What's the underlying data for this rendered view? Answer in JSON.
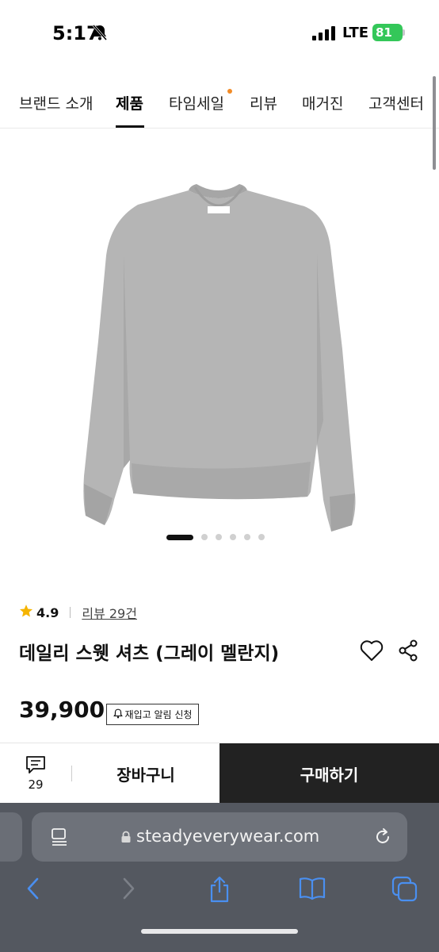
{
  "status_bar": {
    "time": "5:17",
    "network": "LTE",
    "battery": "81",
    "icons": [
      "bell-slash-icon",
      "signal-icon",
      "battery-icon"
    ]
  },
  "nav": {
    "items": [
      {
        "label": "브랜드 소개",
        "active": false
      },
      {
        "label": "제품",
        "active": true
      },
      {
        "label": "타임세일",
        "active": false,
        "badge": "new-dot"
      },
      {
        "label": "리뷰",
        "active": false
      },
      {
        "label": "매거진",
        "active": false
      },
      {
        "label": "고객센터",
        "active": false
      }
    ]
  },
  "product": {
    "image": "grey-sweatshirt",
    "carousel": {
      "count": 6,
      "current": 1
    },
    "rating": "4.9",
    "review_link": "리뷰 29건",
    "title": "데일리 스웻 셔츠 (그레이 멜란지)",
    "price": "39,900",
    "restock_label": "재입고 알림 신청"
  },
  "purchase_bar": {
    "review_count": "29",
    "cart_label": "장바구니",
    "buy_label": "구매하기"
  },
  "browser": {
    "url": "steadyeverywear.com",
    "toolbar_icons": [
      "back-icon",
      "forward-icon",
      "share-icon",
      "bookmarks-icon",
      "tabs-icon"
    ]
  },
  "colors": {
    "accent_dot": "#f28c28",
    "star": "#f5b400",
    "buy_button": "#222222",
    "battery": "#34c759",
    "safari_bar": "#545860",
    "safari_link": "#4a8ff0"
  }
}
